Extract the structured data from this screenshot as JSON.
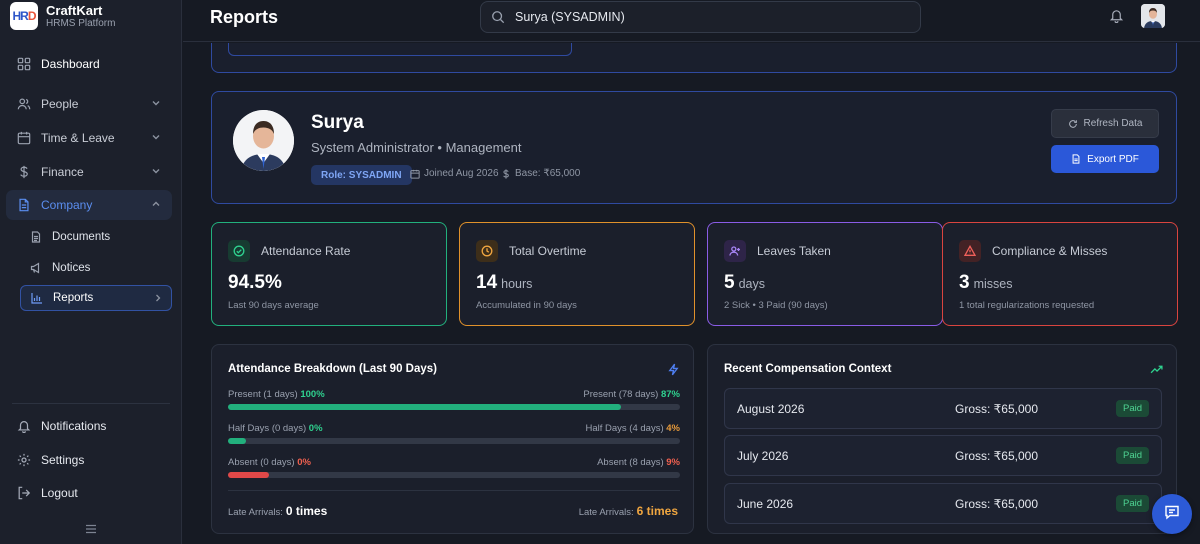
{
  "brand": {
    "logo_text": "HR",
    "name": "CraftKart",
    "subtitle": "HRMS Platform"
  },
  "sidebar": {
    "items": [
      {
        "label": "Dashboard",
        "icon": "grid-icon"
      },
      {
        "label": "People",
        "icon": "users-icon"
      },
      {
        "label": "Time & Leave",
        "icon": "calendar-icon"
      },
      {
        "label": "Finance",
        "icon": "dollar-icon"
      },
      {
        "label": "Company",
        "icon": "building-icon"
      }
    ],
    "subitems": [
      {
        "label": "Documents",
        "icon": "document-icon"
      },
      {
        "label": "Notices",
        "icon": "megaphone-icon"
      },
      {
        "label": "Reports",
        "icon": "chart-icon"
      }
    ],
    "bottom": [
      {
        "label": "Notifications",
        "icon": "bell-icon"
      },
      {
        "label": "Settings",
        "icon": "gear-icon"
      },
      {
        "label": "Logout",
        "icon": "logout-icon"
      }
    ]
  },
  "header": {
    "title": "Reports",
    "search_value": "Surya (SYSADMIN)"
  },
  "profile": {
    "name": "Surya",
    "role_line": "System Administrator • Management",
    "role_badge": "Role: SYSADMIN",
    "joined": "Joined Aug 2026",
    "base": "Base: ₹65,000",
    "refresh_label": "Refresh Data",
    "export_label": "Export PDF"
  },
  "stats": {
    "attendance": {
      "title": "Attendance Rate",
      "value": "94.5%",
      "unit": "",
      "sub": "Last 90 days average",
      "color": "#22b07d"
    },
    "overtime": {
      "title": "Total Overtime",
      "value": "14",
      "unit": "hours",
      "sub": "Accumulated in 90 days",
      "color": "#e0912b"
    },
    "leaves": {
      "title": "Leaves Taken",
      "value": "5",
      "unit": "days",
      "sub": "2 Sick • 3 Paid (90 days)",
      "color": "#8a5ce6"
    },
    "compliance": {
      "title": "Compliance & Misses",
      "value": "3",
      "unit": "misses",
      "sub": "1 total regularizations requested",
      "color": "#d9443f"
    }
  },
  "attendance_breakdown": {
    "title": "Attendance Breakdown (Last 90 Days)",
    "rows": [
      {
        "left_label": "Present (1 days)",
        "left_pct": "100%",
        "right_label": "Present (78 days)",
        "right_pct": "87%",
        "fill": 0.87,
        "color": "#22b07d",
        "pct_color": "#2fd18f"
      },
      {
        "left_label": "Half Days (0 days)",
        "left_pct": "0%",
        "right_label": "Half Days (4 days)",
        "right_pct": "4%",
        "fill": 0.04,
        "color": "#22b07d",
        "pct_color": "#e79a3a"
      },
      {
        "left_label": "Absent (0 days)",
        "left_pct": "0%",
        "right_label": "Absent (8 days)",
        "right_pct": "9%",
        "fill": 0.09,
        "color": "#e04848",
        "pct_color": "#f0604f"
      }
    ],
    "late_left_label": "Late Arrivals:",
    "late_left_value": "0 times",
    "late_right_label": "Late Arrivals:",
    "late_right_value": "6 times"
  },
  "compensation": {
    "title": "Recent Compensation Context",
    "rows": [
      {
        "month": "August 2026",
        "gross": "Gross: ₹65,000",
        "status": "Paid"
      },
      {
        "month": "July 2026",
        "gross": "Gross: ₹65,000",
        "status": "Paid"
      },
      {
        "month": "June 2026",
        "gross": "Gross: ₹65,000",
        "status": "Paid"
      }
    ]
  }
}
